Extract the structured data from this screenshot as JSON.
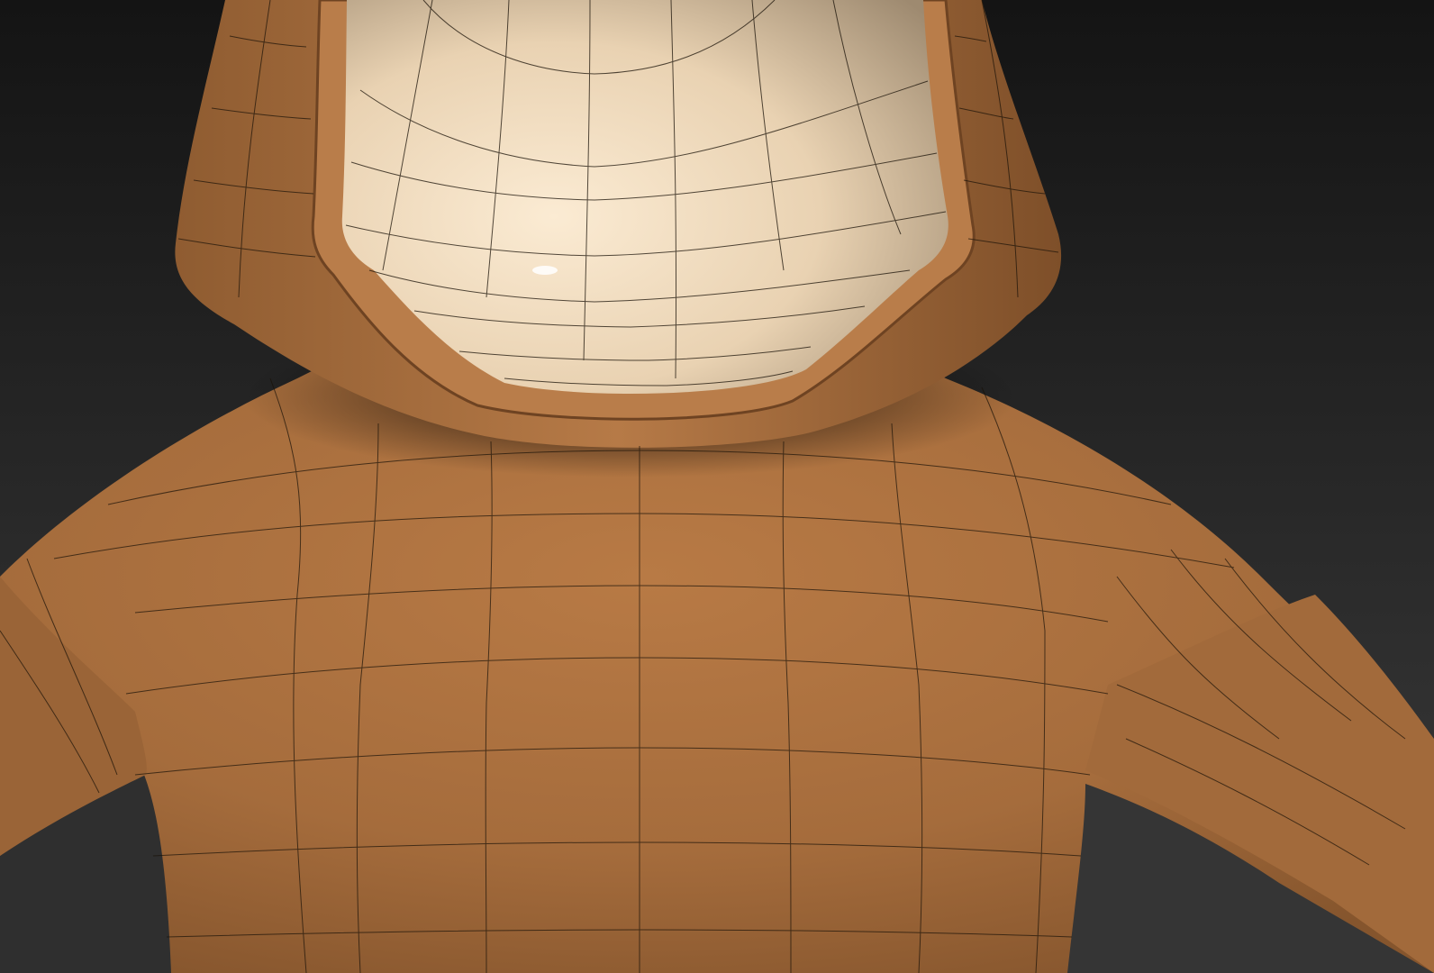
{
  "scene": {
    "subject": "hooded-character-model-wireframe",
    "colors": {
      "background_top": "#151515",
      "background_bottom": "#3a3a3a",
      "fabric": "#a8703f",
      "fabric_light": "#c2854f",
      "fabric_dark": "#7a4c27",
      "skin": "#f1dcc0",
      "skin_shadow": "#bfa789",
      "wire": "#1a1208"
    }
  }
}
